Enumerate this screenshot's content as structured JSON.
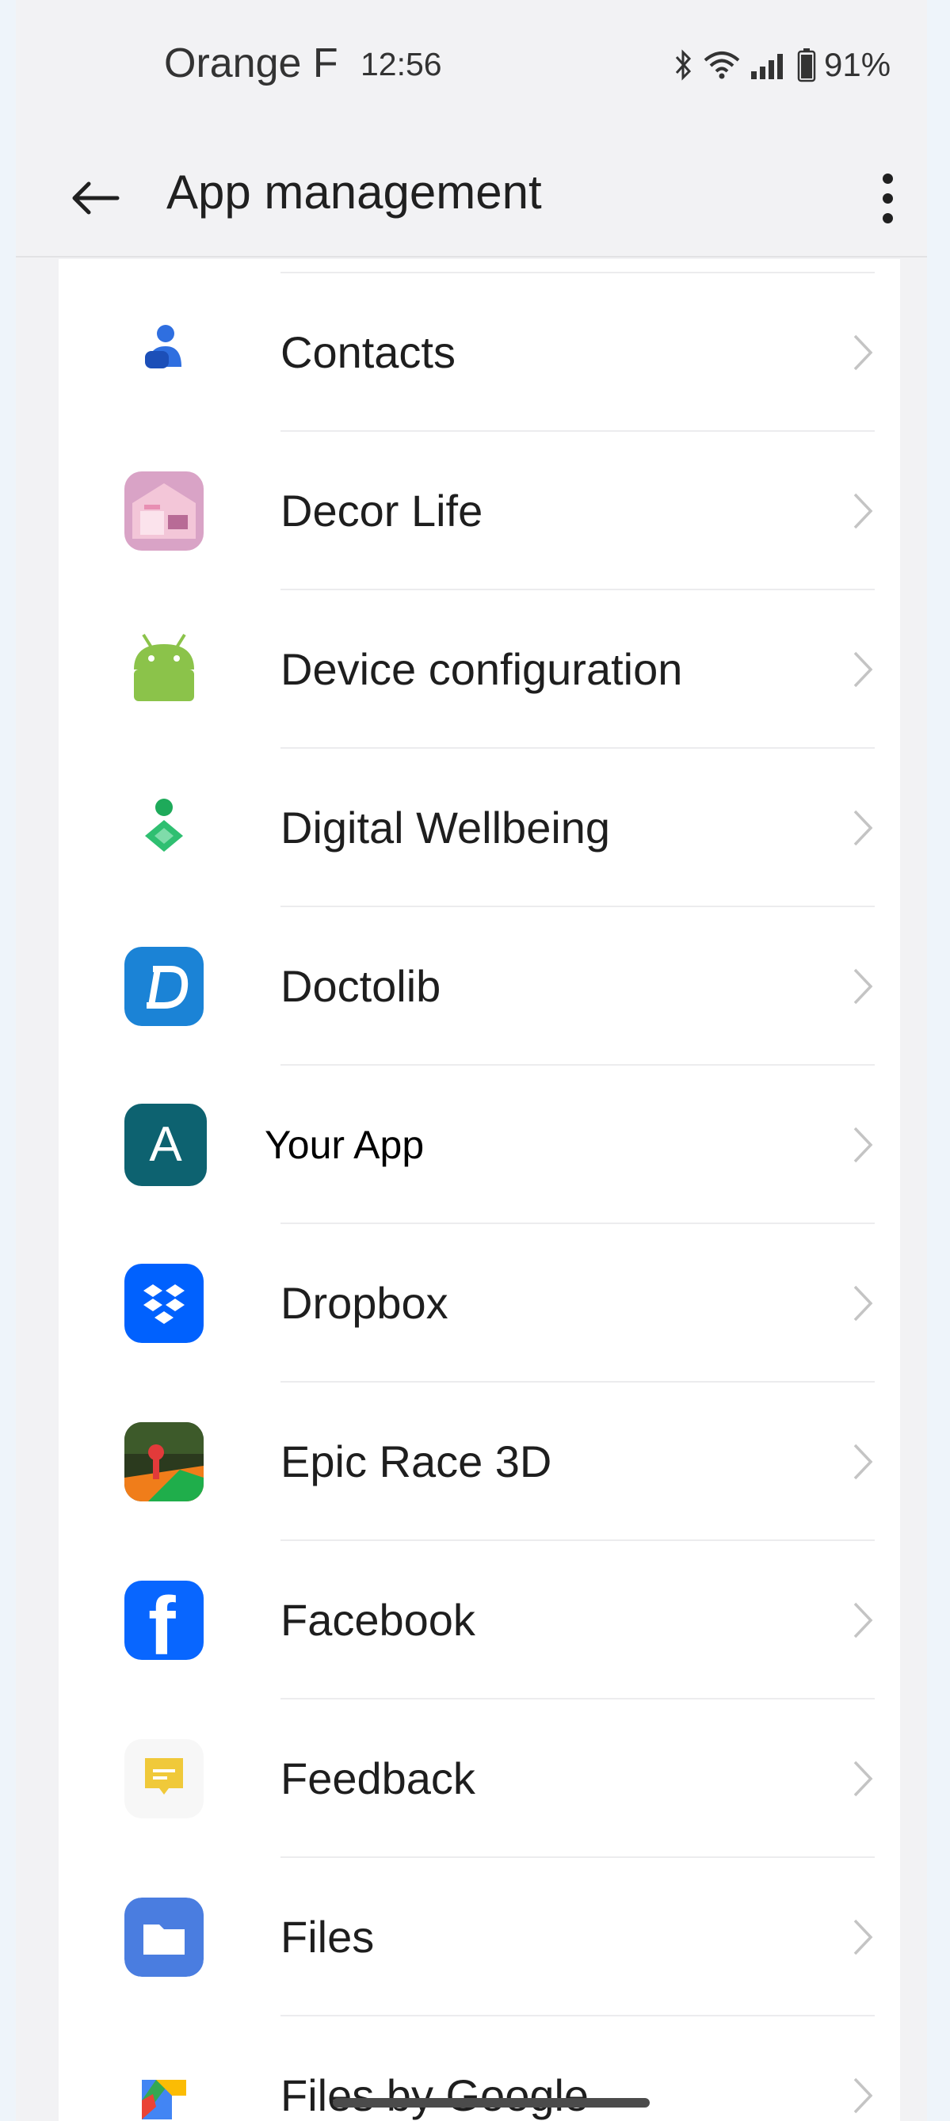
{
  "status_bar": {
    "carrier": "Orange F",
    "time": "12:56",
    "battery": "91%"
  },
  "header": {
    "title": "App management"
  },
  "apps": [
    {
      "name": "Contacts",
      "icon": "contacts-icon"
    },
    {
      "name": "Decor Life",
      "icon": "decor-life-icon"
    },
    {
      "name": "Device configuration",
      "icon": "android-icon"
    },
    {
      "name": "Digital Wellbeing",
      "icon": "digital-wellbeing-icon"
    },
    {
      "name": "Doctolib",
      "icon": "doctolib-icon"
    },
    {
      "name": "Your App",
      "icon": "your-app-icon",
      "icon_letter": "A"
    },
    {
      "name": "Dropbox",
      "icon": "dropbox-icon"
    },
    {
      "name": "Epic Race 3D",
      "icon": "epic-race-icon"
    },
    {
      "name": "Facebook",
      "icon": "facebook-icon",
      "icon_letter": "f"
    },
    {
      "name": "Feedback",
      "icon": "feedback-icon"
    },
    {
      "name": "Files",
      "icon": "files-icon"
    },
    {
      "name": "Files by Google",
      "icon": "files-by-google-icon"
    }
  ],
  "colors": {
    "accent_blue": "#2f6fe0",
    "your_app_teal": "#0d6270",
    "dropbox_blue": "#0061fe",
    "facebook_blue": "#0866ff",
    "android_green": "#8bc34a"
  }
}
